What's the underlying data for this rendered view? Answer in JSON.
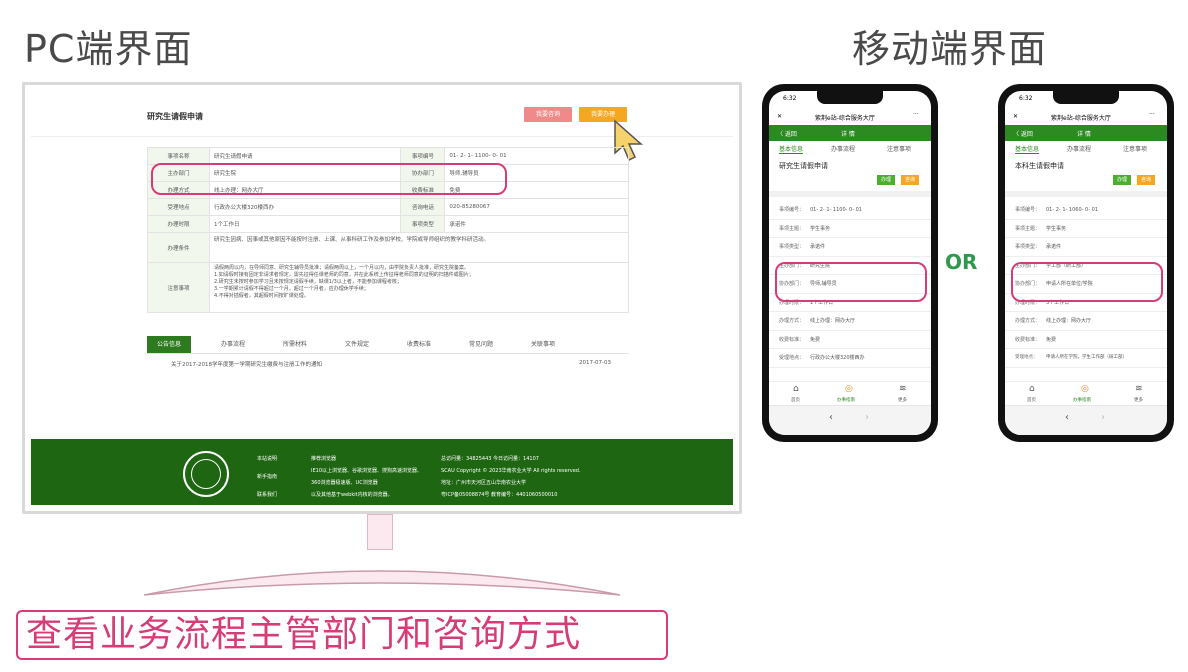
{
  "headings": {
    "pc": "PC端界面",
    "mobile": "移动端界面"
  },
  "pc": {
    "page_title": "研究生请假申请",
    "btn_consult": "我要咨询",
    "btn_apply": "我要办理",
    "rows": [
      {
        "l1": "事项名称",
        "v1": "研究生请假申请",
        "l2": "事项编号",
        "v2": "01- 2- 1- 1100- 0- 01"
      },
      {
        "l1": "主办部门",
        "v1": "研究生院",
        "l2": "协办部门",
        "v2": "导师,辅导员"
      },
      {
        "l1": "办理方式",
        "v1": "线上办理：网办大厅",
        "l2": "收费标准",
        "v2": "免费"
      },
      {
        "l1": "受理地点",
        "v1": "行政办公大楼320楼西办",
        "l2": "咨询电话",
        "v2": "020-85280067"
      },
      {
        "l1": "办理时限",
        "v1": "1个工作日",
        "l2": "事项类型",
        "v2": "承诺件"
      }
    ],
    "condition_label": "办理条件",
    "condition_text": "研究生因病、因事或其他原因不能按时注册、上课、从事科研工作及参加学校、学院或导师组织的教学科研活动。",
    "notes_label": "注意事项",
    "notes_lines": [
      "请假两周以内，在导师同意、研究生辅导员批准；请假两周以上，一个月以内，由学院负责人批准，研究生院备案。",
      "1.如请假时接有固定非请求者规定，需先征得任课老师的同意，并在此系统上传征得老师同意的证明的扫描件或图片；",
      "2.研究生未按时参加学习且未按规定请假手续，缺课1/3以上者，不能参加课程考核；",
      "3.一学期累计请假不得超过一个月，超过一个月者，应办理休学手续；",
      "4.不得对插假者，其超假时间按旷课处理。"
    ],
    "tabs": [
      "公告信息",
      "办事流程",
      "所需材料",
      "文件规定",
      "收费标准",
      "常见问题",
      "关联事项"
    ],
    "notice_title": "关于2017-2018学年度第一学期研究生缴费与注册工作的通知",
    "notice_date": "2017-07-03",
    "footer": {
      "col1": [
        "本站说明",
        "新手指南",
        "联系我们"
      ],
      "col2": [
        "推荐浏览器",
        "IE10以上浏览器、谷歌浏览器、搜狗高速浏览器、",
        "360浏览器极速版、UC浏览器",
        "以及其他基于webkit内核的浏览器。"
      ],
      "col3": [
        "总访问量：34825443  今日访问量：14107",
        "SCAU Copyright © 2023华南农业大学 All rights reserved.",
        "地址：广州市天河区五山华南农业大学",
        "粤ICP备05008874号  教育编号：4401060500010"
      ]
    }
  },
  "phone1": {
    "time": "6:32",
    "app_title": "紫荆e站-综合服务大厅",
    "back": "〈 返回",
    "detail": "详 情",
    "tabs": [
      "基本信息",
      "办事流程",
      "注意事项"
    ],
    "title": "研究生请假申请",
    "btn_apply": "办理",
    "btn_consult": "咨询",
    "rows": [
      {
        "k": "事项编号：",
        "v": "01- 2- 1- 1100- 0- 01"
      },
      {
        "k": "事项主题：",
        "v": "学生事务"
      },
      {
        "k": "事项类型：",
        "v": "承诺件"
      },
      {
        "k": "主办部门：",
        "v": "研究生院"
      },
      {
        "k": "协办部门：",
        "v": "导师,辅导员"
      },
      {
        "k": "办理时限：",
        "v": "1个工作日"
      },
      {
        "k": "办理方式：",
        "v": "线上办理：网办大厅"
      },
      {
        "k": "收费标准：",
        "v": "免费"
      },
      {
        "k": "受理地点：",
        "v": "行政办公大楼320楼西办"
      }
    ],
    "nav": [
      "首页",
      "办事指南",
      "更多"
    ]
  },
  "phone2": {
    "time": "6:32",
    "app_title": "紫荆e站-综合服务大厅",
    "back": "〈 返回",
    "detail": "详 情",
    "tabs": [
      "基本信息",
      "办事流程",
      "注意事项"
    ],
    "title": "本科生请假申请",
    "btn_apply": "办理",
    "btn_consult": "咨询",
    "rows": [
      {
        "k": "事项编号：",
        "v": "01- 2- 1- 1060- 0- 01"
      },
      {
        "k": "事项主题：",
        "v": "学生事务"
      },
      {
        "k": "事项类型：",
        "v": "承诺件"
      },
      {
        "k": "主办部门：",
        "v": "学工部（研工部）"
      },
      {
        "k": "协办部门：",
        "v": "申请人所在单位/学院"
      },
      {
        "k": "办理时限：",
        "v": "3个工作日"
      },
      {
        "k": "办理方式：",
        "v": "线上办理：网办大厅"
      },
      {
        "k": "收费标准：",
        "v": "免费"
      },
      {
        "k": "受理地点：",
        "v": "申请人所在学院，学生工作部（研工部）"
      }
    ],
    "nav": [
      "首页",
      "办事指南",
      "更多"
    ]
  },
  "or_label": "OR",
  "caption": "查看业务流程主管部门和咨询方式",
  "colors": {
    "green": "#2d7a1f",
    "footer_green": "#1e6612",
    "highlight": "#d63c77",
    "orange": "#f5a623",
    "pink_btn": "#f08a8a"
  }
}
